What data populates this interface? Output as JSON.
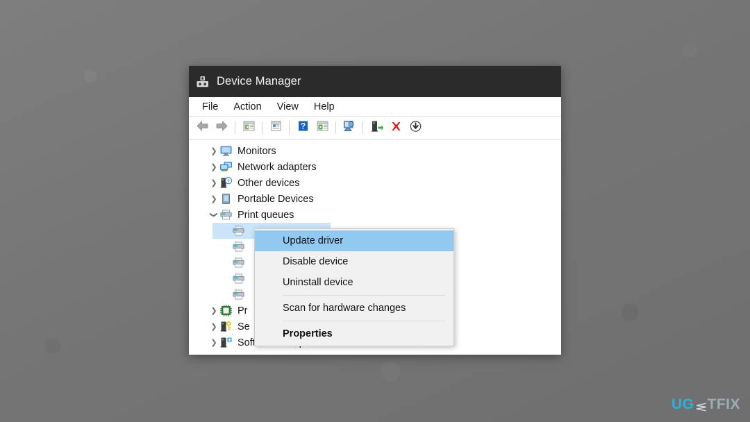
{
  "window": {
    "title": "Device Manager",
    "title_icon": "device-manager-icon",
    "menubar": [
      {
        "label": "File",
        "name": "menu-file"
      },
      {
        "label": "Action",
        "name": "menu-action"
      },
      {
        "label": "View",
        "name": "menu-view"
      },
      {
        "label": "Help",
        "name": "menu-help"
      }
    ],
    "toolbar": [
      {
        "name": "back-icon",
        "glyph": "back"
      },
      {
        "name": "forward-icon",
        "glyph": "forward"
      },
      {
        "name": "separator",
        "glyph": "sep"
      },
      {
        "name": "show-hide-console-tree-icon",
        "glyph": "console-tree"
      },
      {
        "name": "separator",
        "glyph": "sep"
      },
      {
        "name": "properties-icon",
        "glyph": "properties"
      },
      {
        "name": "separator",
        "glyph": "sep"
      },
      {
        "name": "help-icon",
        "glyph": "help"
      },
      {
        "name": "show-hide-action-pane-icon",
        "glyph": "action-pane"
      },
      {
        "name": "separator",
        "glyph": "sep"
      },
      {
        "name": "scan-for-hardware-changes-icon",
        "glyph": "scan"
      },
      {
        "name": "separator",
        "glyph": "sep"
      },
      {
        "name": "update-driver-icon",
        "glyph": "update-driver"
      },
      {
        "name": "uninstall-device-icon",
        "glyph": "uninstall"
      },
      {
        "name": "disable-device-icon",
        "glyph": "disable"
      }
    ]
  },
  "tree": {
    "items": [
      {
        "label": "Monitors",
        "icon": "monitor-icon",
        "expanded": false,
        "child": false
      },
      {
        "label": "Network adapters",
        "icon": "network-adapter-icon",
        "expanded": false,
        "child": false
      },
      {
        "label": "Other devices",
        "icon": "other-device-icon",
        "expanded": false,
        "child": false
      },
      {
        "label": "Portable Devices",
        "icon": "portable-device-icon",
        "expanded": false,
        "child": false
      },
      {
        "label": "Print queues",
        "icon": "print-queue-icon",
        "expanded": true,
        "child": false
      },
      {
        "label": "",
        "icon": "printer-icon",
        "child": true,
        "selected": true
      },
      {
        "label": "",
        "icon": "printer-icon",
        "child": true
      },
      {
        "label": "",
        "icon": "printer-icon",
        "child": true
      },
      {
        "label": "",
        "icon": "printer-icon",
        "child": true
      },
      {
        "label": "",
        "icon": "printer-icon",
        "child": true
      },
      {
        "label": "Pr",
        "icon": "processor-icon",
        "expanded": false,
        "child": false
      },
      {
        "label": "Se",
        "icon": "security-device-icon",
        "expanded": false,
        "child": false
      },
      {
        "label": "Software components",
        "icon": "software-component-icon",
        "expanded": false,
        "child": false
      }
    ]
  },
  "context_menu": {
    "items": [
      {
        "label": "Update driver",
        "name": "ctx-update-driver",
        "highlighted": true,
        "bold": false,
        "separator_before": false
      },
      {
        "label": "Disable device",
        "name": "ctx-disable-device",
        "highlighted": false,
        "bold": false,
        "separator_before": false
      },
      {
        "label": "Uninstall device",
        "name": "ctx-uninstall-device",
        "highlighted": false,
        "bold": false,
        "separator_before": false
      },
      {
        "label": "Scan for hardware changes",
        "name": "ctx-scan-hardware-changes",
        "highlighted": false,
        "bold": false,
        "separator_before": true
      },
      {
        "label": "Properties",
        "name": "ctx-properties",
        "highlighted": false,
        "bold": true,
        "separator_before": true
      }
    ]
  },
  "watermark": {
    "part1": "UG",
    "part2": "TFIX"
  },
  "colors": {
    "titlebar": "#2b2b2b",
    "menu_highlight": "#92c9f0",
    "tree_selection": "#cce4f7",
    "menu_bg": "#f1f1f1",
    "desktop": "#787878",
    "watermark_accent": "#27b7e8"
  }
}
